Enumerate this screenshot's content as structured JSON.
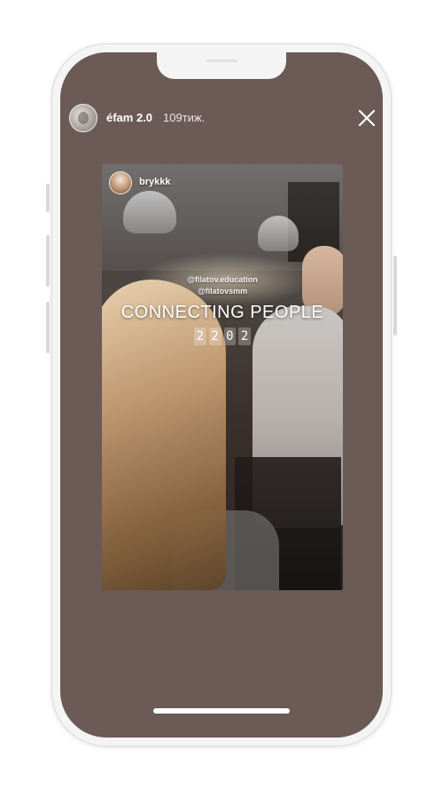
{
  "story": {
    "account_name": "éfam 2.0",
    "time_ago": "109тиж."
  },
  "card": {
    "poster_username": "brykkk",
    "mention_1": "@filatov.education",
    "mention_2": "@filatovsmm",
    "headline": "CONNECTING PEOPLE",
    "date_digits": [
      "2",
      "2",
      "0",
      "2"
    ]
  },
  "icons": {
    "close": "close-icon",
    "avatar": "avatar"
  },
  "colors": {
    "screen_background": "#6b5a56",
    "text": "#ffffff"
  }
}
